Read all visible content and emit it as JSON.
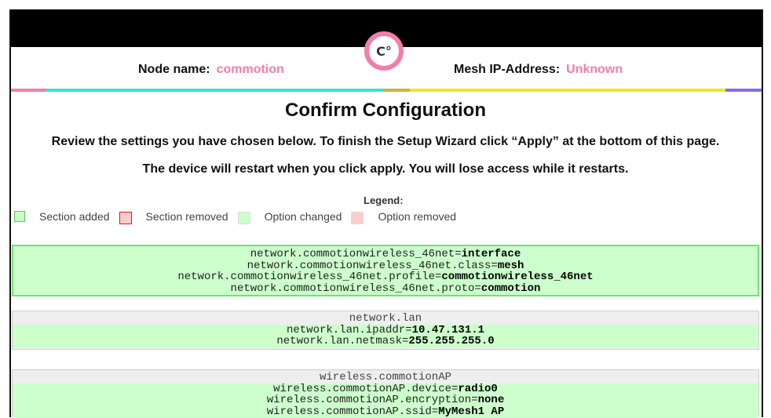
{
  "header": {
    "node_label": "Node name:",
    "node_value": "commotion",
    "mesh_label": "Mesh IP-Address:",
    "mesh_value": "Unknown",
    "logo_text": "C°",
    "brand_color": "#f27ea7"
  },
  "page": {
    "title": "Confirm Configuration",
    "instructions": "Review the settings you have chosen below. To finish the Setup Wizard click “Apply” at the bottom of this page.",
    "warning": "The device will restart when you click apply. You will lose access while it restarts."
  },
  "legend": {
    "title": "Legend:",
    "items": [
      {
        "label": "Section added",
        "color": "#ccffcc",
        "border": "#55cc55"
      },
      {
        "label": "Section removed",
        "color": "#ffcccc",
        "border": "#cc2222"
      },
      {
        "label": "Option changed",
        "color": "#ccffcc",
        "border": "#dddddd"
      },
      {
        "label": "Option removed",
        "color": "#ffcccc",
        "border": "#dddddd"
      }
    ]
  },
  "changes": {
    "block1": {
      "lines": [
        {
          "key": "network.commotionwireless_46net=",
          "val": "interface"
        },
        {
          "key": "network.commotionwireless_46net.class=",
          "val": "mesh"
        },
        {
          "key": "network.commotionwireless_46net.profile=",
          "val": "commotionwireless_46net"
        },
        {
          "key": "network.commotionwireless_46net.proto=",
          "val": "commotion"
        }
      ]
    },
    "block2": {
      "section": "network.lan",
      "lines": [
        {
          "key": "network.lan.ipaddr=",
          "val": "10.47.131.1"
        },
        {
          "key": "network.lan.netmask=",
          "val": "255.255.255.0"
        }
      ]
    },
    "block3": {
      "section": "wireless.commotionAP",
      "lines": [
        {
          "key": "wireless.commotionAP.device=",
          "val": "radio0"
        },
        {
          "key": "wireless.commotionAP.encryption=",
          "val": "none"
        },
        {
          "key": "wireless.commotionAP.ssid=",
          "val": "MyMesh1 AP"
        }
      ]
    }
  }
}
